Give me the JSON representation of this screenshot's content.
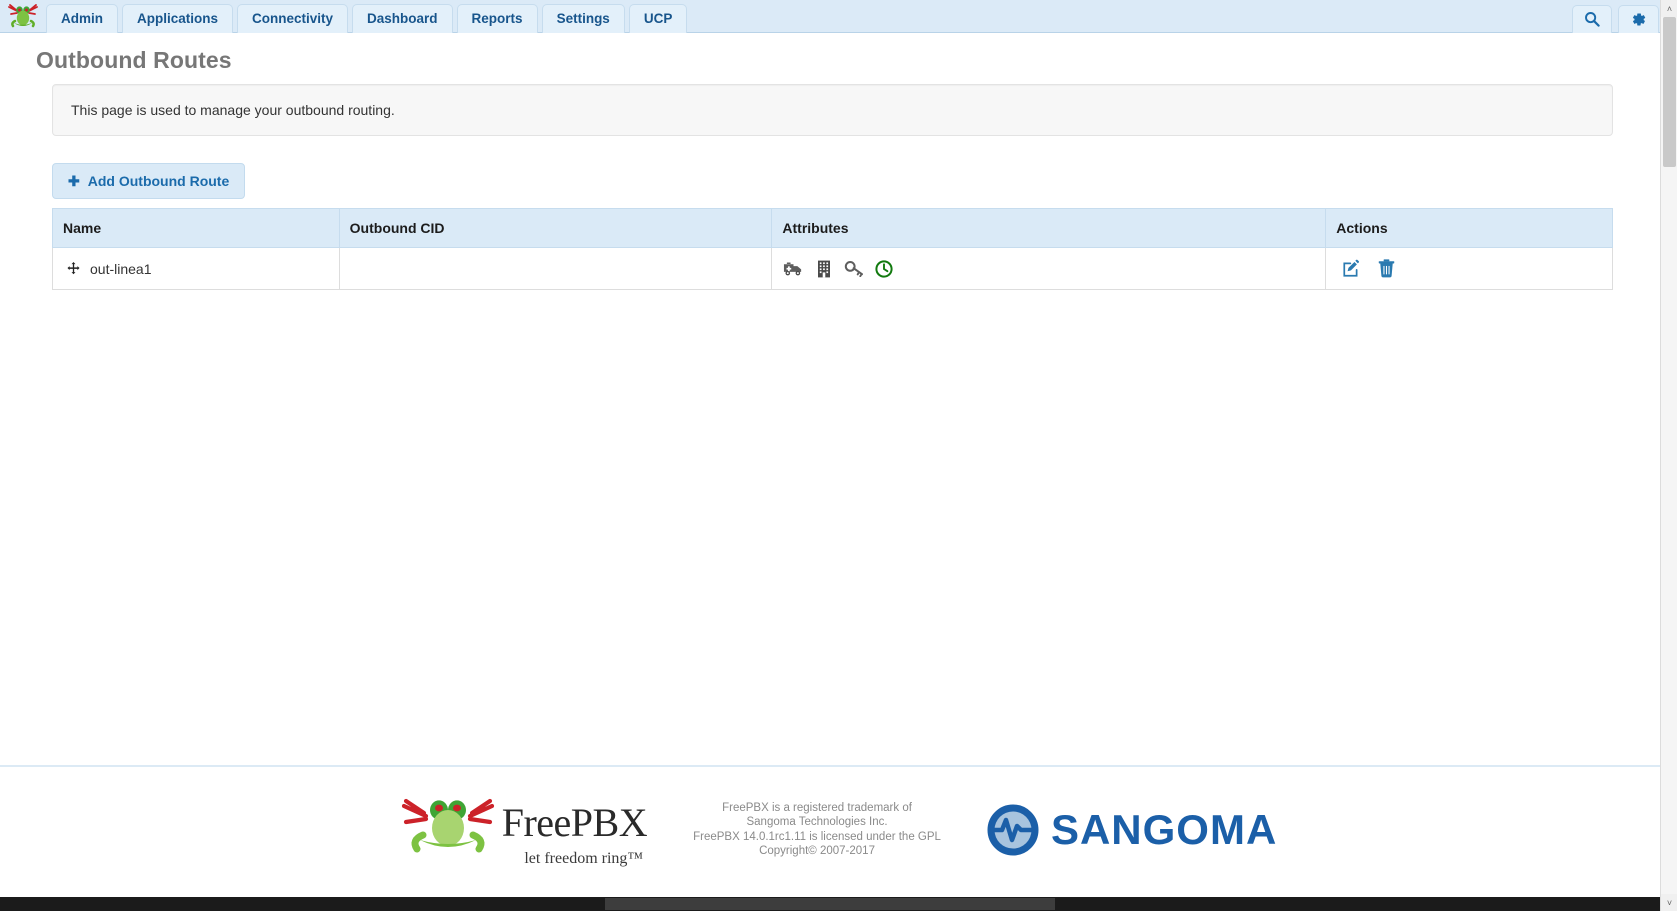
{
  "navbar": {
    "logo_icon": "freepbx-frog-logo",
    "items": [
      {
        "label": "Admin",
        "name": "nav-item-admin"
      },
      {
        "label": "Applications",
        "name": "nav-item-applications"
      },
      {
        "label": "Connectivity",
        "name": "nav-item-connectivity"
      },
      {
        "label": "Dashboard",
        "name": "nav-item-dashboard"
      },
      {
        "label": "Reports",
        "name": "nav-item-reports"
      },
      {
        "label": "Settings",
        "name": "nav-item-settings"
      },
      {
        "label": "UCP",
        "name": "nav-item-ucp"
      }
    ],
    "search_icon": "search-icon",
    "gear_icon": "gear-icon",
    "colors": {
      "bar_bg": "#dbeaf7",
      "tab_bg": "#e3f0fa",
      "tab_text": "#18558c"
    }
  },
  "page": {
    "title": "Outbound Routes",
    "info_text": "This page is used to manage your outbound routing."
  },
  "toolbar": {
    "add_label": "Add Outbound Route",
    "add_icon": "plus-icon",
    "plus_glyph": "✚"
  },
  "table": {
    "headers": [
      "Name",
      "Outbound CID",
      "Attributes",
      "Actions"
    ],
    "rows": [
      {
        "name": "out-linea1",
        "outbound_cid": "",
        "drag_icon": "move-handle-icon",
        "attributes": [
          {
            "icon": "ambulance-emergency-icon",
            "title": "Emergency Route"
          },
          {
            "icon": "building-intracompany-icon",
            "title": "Intra-Company Route"
          },
          {
            "icon": "key-password-icon",
            "title": "Route Password"
          },
          {
            "icon": "clock-time-group-icon",
            "title": "Time Group"
          }
        ],
        "actions": [
          {
            "icon": "edit-pencil-icon",
            "label": "Edit"
          },
          {
            "icon": "trash-delete-icon",
            "label": "Delete"
          }
        ]
      }
    ]
  },
  "footer": {
    "freepbx_name": "FreePBX",
    "freepbx_tagline": "let freedom ring™",
    "legal_lines": [
      "FreePBX is a registered trademark of",
      "Sangoma Technologies Inc.",
      "FreePBX 14.0.1rc1.11 is licensed under the GPL",
      "Copyright© 2007-2017"
    ],
    "sangoma_name": "SANGOMA",
    "sangoma_icon": "sangoma-waveform-logo"
  },
  "scrollbars": {
    "vertical_up_arrow": "˄",
    "vertical_down_arrow": "˅"
  }
}
